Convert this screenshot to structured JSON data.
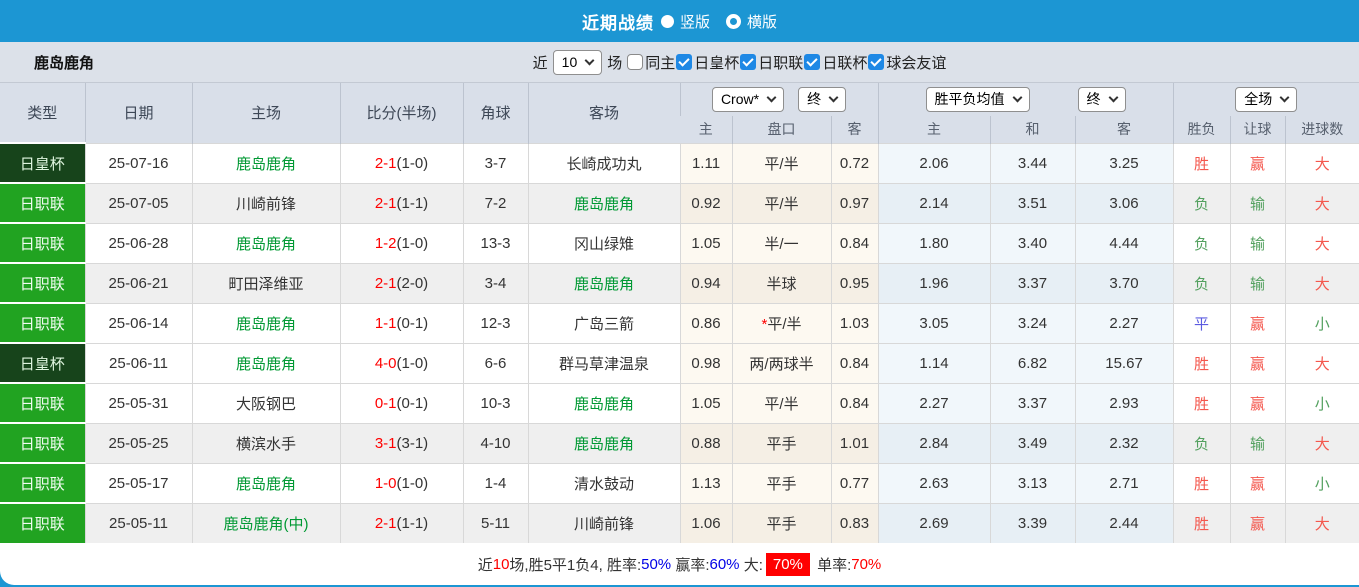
{
  "colors": {
    "accent_blue": "#1C96D3",
    "league_badge_green": "#21A321",
    "cup_badge_green": "#17441B",
    "team_green": "#009933",
    "score_red": "#FF0000",
    "win_red": "#F4574D",
    "lose_green": "#52A05E",
    "draw_blue": "#5B5BE0",
    "rate_blue": "#0000E6"
  },
  "icons": {
    "chevron_down_icon": "css-shape ∨",
    "radio_filled_icon": "●",
    "radio_ring_icon": "○",
    "checkbox_checked_icon": "✓"
  },
  "titlebar": {
    "title": "近期战绩",
    "radio_vertical_label": "竖版",
    "radio_horizontal_label": "横版",
    "selected": "竖版"
  },
  "filter": {
    "team": "鹿岛鹿角",
    "near_label": "近",
    "count_value": "10",
    "games_label": "场",
    "checkboxes": [
      {
        "label": "同主",
        "checked": false
      },
      {
        "label": "日皇杯",
        "checked": true
      },
      {
        "label": "日职联",
        "checked": true
      },
      {
        "label": "日联杯",
        "checked": true
      },
      {
        "label": "球会友谊",
        "checked": true
      }
    ]
  },
  "table": {
    "columns": [
      "类型",
      "日期",
      "主场",
      "比分(半场)",
      "角球",
      "客场"
    ],
    "selects": {
      "company": "Crow*",
      "time1": "终",
      "avg": "胜平负均值",
      "time2": "终",
      "scope": "全场"
    },
    "subheaders": [
      "主",
      "盘口",
      "客",
      "主",
      "和",
      "客",
      "胜负",
      "让球",
      "进球数"
    ],
    "rows": [
      {
        "type": "日皇杯",
        "cup": true,
        "date": "25-07-16",
        "home": "鹿岛鹿角",
        "home_team": true,
        "score": "2-1",
        "half": "(1-0)",
        "corner": "3-7",
        "away": "长崎成功丸",
        "away_team": false,
        "odds_home": "1.11",
        "handicap": "平/半",
        "star": false,
        "odds_away": "0.72",
        "avg_win": "2.06",
        "avg_draw": "3.44",
        "avg_lose": "3.25",
        "result": "胜",
        "result_c": "red",
        "spread": "赢",
        "spread_c": "red",
        "goals": "大",
        "goals_c": "red",
        "shade": "light"
      },
      {
        "type": "日职联",
        "cup": false,
        "date": "25-07-05",
        "home": "川崎前锋",
        "home_team": false,
        "score": "2-1",
        "half": "(1-1)",
        "corner": "7-2",
        "away": "鹿岛鹿角",
        "away_team": true,
        "odds_home": "0.92",
        "handicap": "平/半",
        "star": false,
        "odds_away": "0.97",
        "avg_win": "2.14",
        "avg_draw": "3.51",
        "avg_lose": "3.06",
        "result": "负",
        "result_c": "green",
        "spread": "输",
        "spread_c": "green",
        "goals": "大",
        "goals_c": "red",
        "shade": "dark"
      },
      {
        "type": "日职联",
        "cup": false,
        "date": "25-06-28",
        "home": "鹿岛鹿角",
        "home_team": true,
        "score": "1-2",
        "half": "(1-0)",
        "corner": "13-3",
        "away": "冈山绿雉",
        "away_team": false,
        "odds_home": "1.05",
        "handicap": "半/一",
        "star": false,
        "odds_away": "0.84",
        "avg_win": "1.80",
        "avg_draw": "3.40",
        "avg_lose": "4.44",
        "result": "负",
        "result_c": "green",
        "spread": "输",
        "spread_c": "green",
        "goals": "大",
        "goals_c": "red",
        "shade": "light"
      },
      {
        "type": "日职联",
        "cup": false,
        "date": "25-06-21",
        "home": "町田泽维亚",
        "home_team": false,
        "score": "2-1",
        "half": "(2-0)",
        "corner": "3-4",
        "away": "鹿岛鹿角",
        "away_team": true,
        "odds_home": "0.94",
        "handicap": "半球",
        "star": false,
        "odds_away": "0.95",
        "avg_win": "1.96",
        "avg_draw": "3.37",
        "avg_lose": "3.70",
        "result": "负",
        "result_c": "green",
        "spread": "输",
        "spread_c": "green",
        "goals": "大",
        "goals_c": "red",
        "shade": "dark"
      },
      {
        "type": "日职联",
        "cup": false,
        "date": "25-06-14",
        "home": "鹿岛鹿角",
        "home_team": true,
        "score": "1-1",
        "half": "(0-1)",
        "corner": "12-3",
        "away": "广岛三箭",
        "away_team": false,
        "odds_home": "0.86",
        "handicap": "平/半",
        "star": true,
        "odds_away": "1.03",
        "avg_win": "3.05",
        "avg_draw": "3.24",
        "avg_lose": "2.27",
        "result": "平",
        "result_c": "blue",
        "spread": "赢",
        "spread_c": "red",
        "goals": "小",
        "goals_c": "green",
        "shade": "light"
      },
      {
        "type": "日皇杯",
        "cup": true,
        "date": "25-06-11",
        "home": "鹿岛鹿角",
        "home_team": true,
        "score": "4-0",
        "half": "(1-0)",
        "corner": "6-6",
        "away": "群马草津温泉",
        "away_team": false,
        "odds_home": "0.98",
        "handicap": "两/两球半",
        "star": false,
        "odds_away": "0.84",
        "avg_win": "1.14",
        "avg_draw": "6.82",
        "avg_lose": "15.67",
        "result": "胜",
        "result_c": "red",
        "spread": "赢",
        "spread_c": "red",
        "goals": "大",
        "goals_c": "red",
        "shade": "light"
      },
      {
        "type": "日职联",
        "cup": false,
        "date": "25-05-31",
        "home": "大阪钢巴",
        "home_team": false,
        "score": "0-1",
        "half": "(0-1)",
        "corner": "10-3",
        "away": "鹿岛鹿角",
        "away_team": true,
        "odds_home": "1.05",
        "handicap": "平/半",
        "star": false,
        "odds_away": "0.84",
        "avg_win": "2.27",
        "avg_draw": "3.37",
        "avg_lose": "2.93",
        "result": "胜",
        "result_c": "red",
        "spread": "赢",
        "spread_c": "red",
        "goals": "小",
        "goals_c": "green",
        "shade": "light"
      },
      {
        "type": "日职联",
        "cup": false,
        "date": "25-05-25",
        "home": "横滨水手",
        "home_team": false,
        "score": "3-1",
        "half": "(3-1)",
        "corner": "4-10",
        "away": "鹿岛鹿角",
        "away_team": true,
        "odds_home": "0.88",
        "handicap": "平手",
        "star": false,
        "odds_away": "1.01",
        "avg_win": "2.84",
        "avg_draw": "3.49",
        "avg_lose": "2.32",
        "result": "负",
        "result_c": "green",
        "spread": "输",
        "spread_c": "green",
        "goals": "大",
        "goals_c": "red",
        "shade": "dark"
      },
      {
        "type": "日职联",
        "cup": false,
        "date": "25-05-17",
        "home": "鹿岛鹿角",
        "home_team": true,
        "score": "1-0",
        "half": "(1-0)",
        "corner": "1-4",
        "away": "清水鼓动",
        "away_team": false,
        "odds_home": "1.13",
        "handicap": "平手",
        "star": false,
        "odds_away": "0.77",
        "avg_win": "2.63",
        "avg_draw": "3.13",
        "avg_lose": "2.71",
        "result": "胜",
        "result_c": "red",
        "spread": "赢",
        "spread_c": "red",
        "goals": "小",
        "goals_c": "green",
        "shade": "light"
      },
      {
        "type": "日职联",
        "cup": false,
        "date": "25-05-11",
        "home": "鹿岛鹿角(中)",
        "home_team": true,
        "score": "2-1",
        "half": "(1-1)",
        "corner": "5-11",
        "away": "川崎前锋",
        "away_team": false,
        "odds_home": "1.06",
        "handicap": "平手",
        "star": false,
        "odds_away": "0.83",
        "avg_win": "2.69",
        "avg_draw": "3.39",
        "avg_lose": "2.44",
        "result": "胜",
        "result_c": "red",
        "spread": "赢",
        "spread_c": "red",
        "goals": "大",
        "goals_c": "red",
        "shade": "dark"
      }
    ]
  },
  "footer": {
    "segments": [
      {
        "text": "近",
        "style": "plain"
      },
      {
        "text": "10",
        "style": "red"
      },
      {
        "text": "场,胜5平1负4, 胜率:",
        "style": "plain"
      },
      {
        "text": "50%",
        "style": "blue"
      },
      {
        "text": " 赢率:",
        "style": "plain"
      },
      {
        "text": "60%",
        "style": "blue"
      },
      {
        "text": " 大:",
        "style": "plain"
      },
      {
        "text": "70%",
        "style": "redbg"
      },
      {
        "text": " 单率:",
        "style": "plain"
      },
      {
        "text": "70%",
        "style": "red"
      }
    ]
  }
}
